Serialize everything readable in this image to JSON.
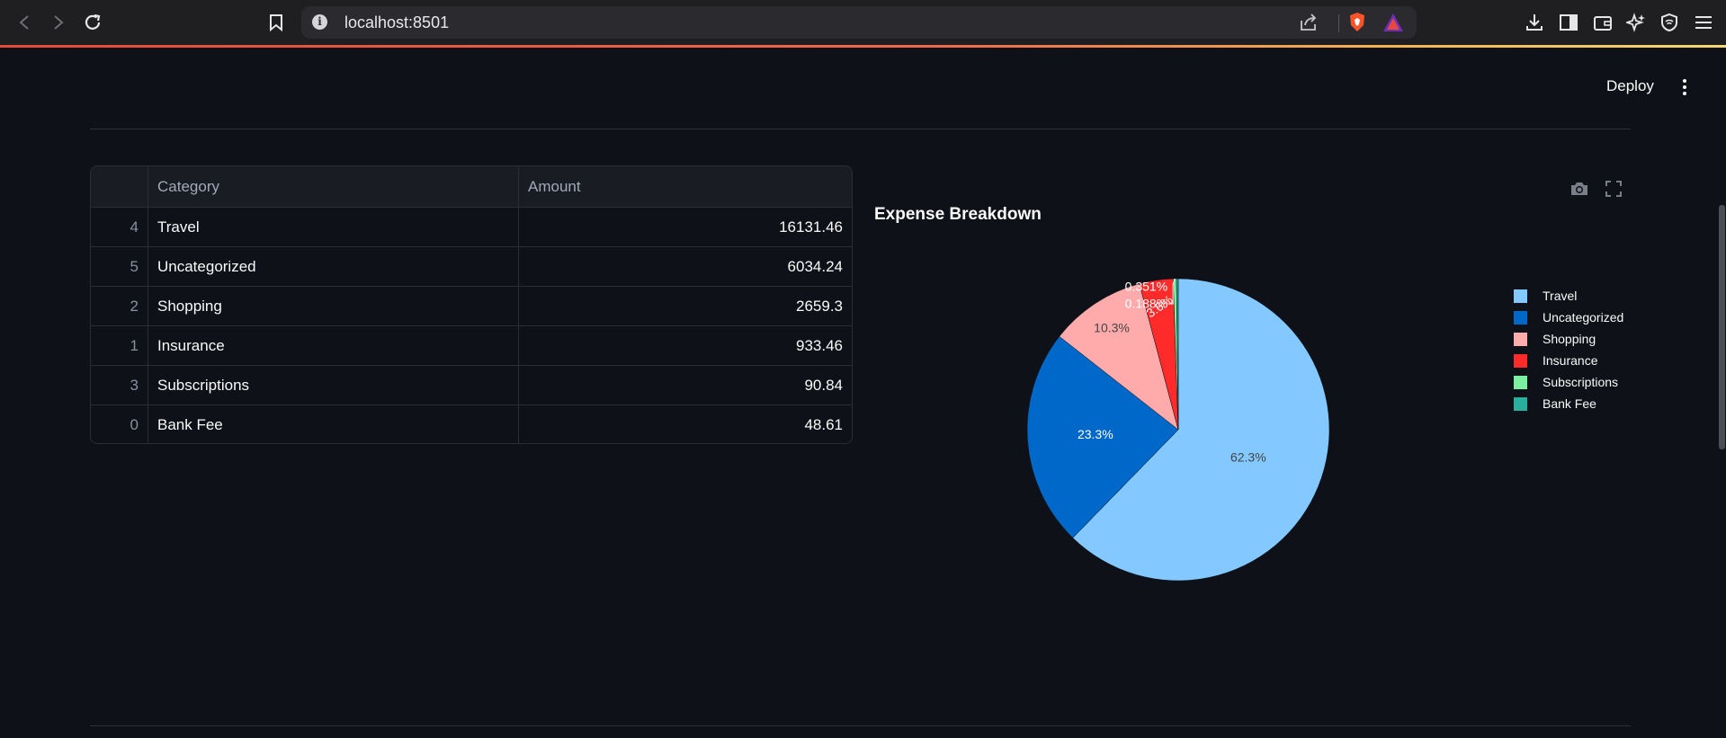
{
  "browser": {
    "url": "localhost:8501"
  },
  "header": {
    "deploy_label": "Deploy"
  },
  "table": {
    "columns": [
      "",
      "Category",
      "Amount"
    ],
    "rows": [
      {
        "index": "4",
        "category": "Travel",
        "amount": "16131.46"
      },
      {
        "index": "5",
        "category": "Uncategorized",
        "amount": "6034.24"
      },
      {
        "index": "2",
        "category": "Shopping",
        "amount": "2659.3"
      },
      {
        "index": "1",
        "category": "Insurance",
        "amount": "933.46"
      },
      {
        "index": "3",
        "category": "Subscriptions",
        "amount": "90.84"
      },
      {
        "index": "0",
        "category": "Bank Fee",
        "amount": "48.61"
      }
    ]
  },
  "chart_data": {
    "type": "pie",
    "title": "Expense Breakdown",
    "categories": [
      "Travel",
      "Uncategorized",
      "Shopping",
      "Insurance",
      "Subscriptions",
      "Bank Fee"
    ],
    "values": [
      16131.46,
      6034.24,
      2659.3,
      933.46,
      90.84,
      48.61
    ],
    "labels": [
      "62.3%",
      "23.3%",
      "10.3%",
      "3.6%",
      "0.351%",
      "0.188%"
    ],
    "colors": [
      "#83c9ff",
      "#0068c9",
      "#ffabab",
      "#ff2b2b",
      "#7defa1",
      "#29b09d"
    ],
    "label_colors": [
      "#444444",
      "#ffffff",
      "#444444",
      "#ffffff",
      "#ffffff",
      "#ffffff"
    ],
    "legend": "right",
    "direction": "clockwise"
  },
  "colors": {
    "background": "#0e1117",
    "accent_line": "#e5493a"
  }
}
